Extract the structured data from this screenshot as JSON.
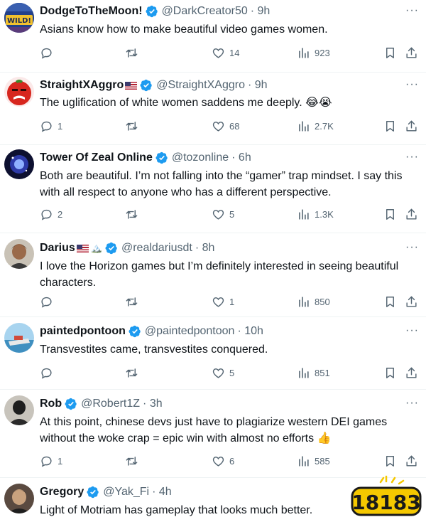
{
  "tweets": [
    {
      "name": "DodgeToTheMoon!",
      "handle": "@DarkCreator50",
      "time": "· 9h",
      "text": "Asians know how to make beautiful video games women.",
      "replies": "",
      "likes": "14",
      "views": "923",
      "avatar_text": "WILD!"
    },
    {
      "name": "StraightXAggro",
      "handle": "@StraightXAggro",
      "time": "· 9h",
      "text": "The uglification of white women saddens me deeply. 😂😭",
      "replies": "1",
      "likes": "68",
      "views": "2.7K"
    },
    {
      "name": "Tower Of Zeal Online",
      "handle": "@tozonline",
      "time": "· 6h",
      "text": "Both are beautiful. I’m not falling into the “gamer” trap mindset. I say this with all respect to anyone who has a different perspective.",
      "replies": "2",
      "likes": "5",
      "views": "1.3K"
    },
    {
      "name": "Darius",
      "handle": "@realdariusdt",
      "time": "· 8h",
      "text": "I love the Horizon games but I’m definitely interested in seeing beautiful characters.",
      "replies": "",
      "likes": "1",
      "views": "850"
    },
    {
      "name": "paintedpontoon",
      "handle": "@paintedpontoon",
      "time": "· 10h",
      "text": "Transvestites came, transvestites conquered.",
      "replies": "",
      "likes": "5",
      "views": "851"
    },
    {
      "name": "Rob",
      "handle": "@Robert1Z",
      "time": "· 3h",
      "text": "At this point, chinese devs just have to plagiarize western DEI games without the woke crap = epic win with almost no efforts 👍",
      "replies": "1",
      "likes": "6",
      "views": "585"
    },
    {
      "name": "Gregory",
      "handle": "@Yak_Fi",
      "time": "· 4h",
      "text": "Light of Motriam has gameplay that looks much better."
    }
  ],
  "more_glyph": "···",
  "watermark_text": "18183",
  "colors": {
    "text": "#0f1419",
    "muted": "#536471",
    "verified": "#1d9bf0",
    "divider": "#eff3f4",
    "watermark": "#f5c800"
  }
}
